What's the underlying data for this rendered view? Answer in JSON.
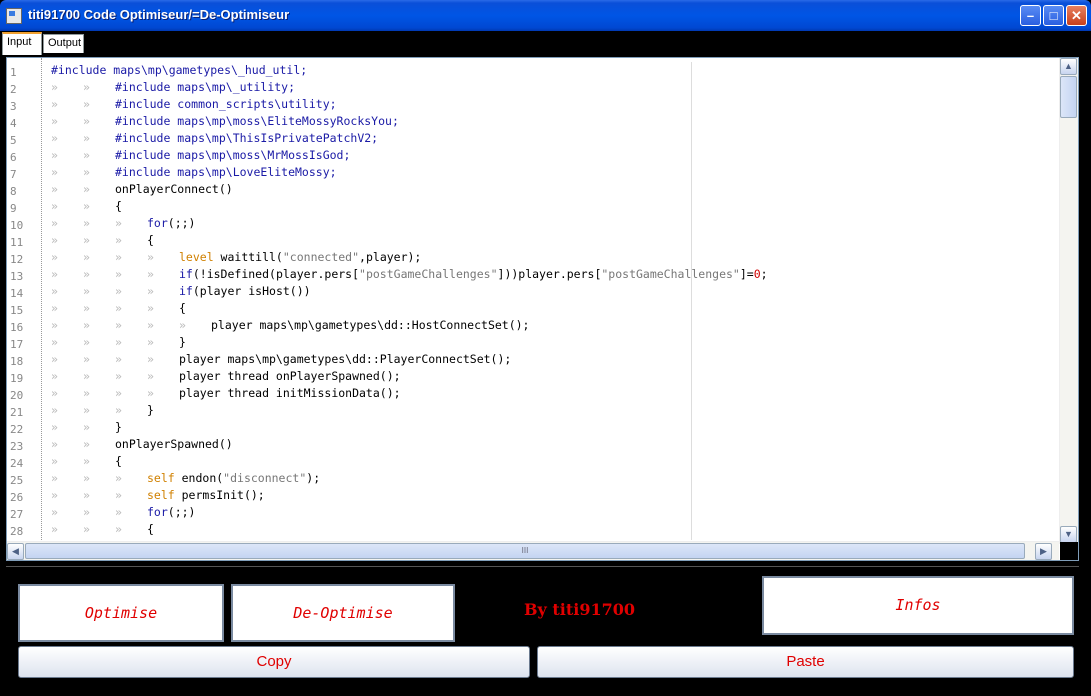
{
  "window": {
    "title": "titi91700 Code Optimiseur/=De-Optimiseur"
  },
  "tabs": [
    {
      "label": "Input"
    },
    {
      "label": "Output"
    }
  ],
  "editor": {
    "line_numbers": [
      "1",
      "2",
      "3",
      "4",
      "5",
      "6",
      "7",
      "8",
      "9",
      "10",
      "11",
      "12",
      "13",
      "14",
      "15",
      "16",
      "17",
      "18",
      "19",
      "20",
      "21",
      "22",
      "23",
      "24",
      "25",
      "26",
      "27",
      "28"
    ]
  },
  "buttons": {
    "optimise": "Optimise",
    "deoptimise": "De-Optimise",
    "infos": "Infos",
    "copy": "Copy",
    "paste": "Paste"
  },
  "byline": "By titi91700",
  "scrollbar": {
    "grip": "III"
  },
  "icons": {
    "app": "app-icon",
    "minimize": "minimize-icon",
    "maximize": "maximize-icon",
    "close": "close-icon"
  },
  "colors": {
    "accent_red": "#e00000",
    "keyword_blue": "#1a1aa6",
    "titlebar": "#0055e5"
  }
}
